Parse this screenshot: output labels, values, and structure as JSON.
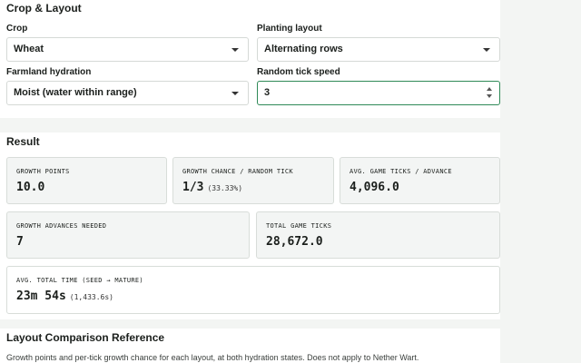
{
  "crop_layout": {
    "title": "Crop & Layout",
    "crop": {
      "label": "Crop",
      "value": "Wheat"
    },
    "planting_layout": {
      "label": "Planting layout",
      "value": "Alternating rows"
    },
    "hydration": {
      "label": "Farmland hydration",
      "value": "Moist (water within range)"
    },
    "tick_speed": {
      "label": "Random tick speed",
      "value": "3"
    }
  },
  "result": {
    "title": "Result",
    "growth_points": {
      "label": "GROWTH POINTS",
      "value": "10.0"
    },
    "growth_chance": {
      "label": "GROWTH CHANCE / RANDOM TICK",
      "value": "1/3",
      "sub": "(33.33%)"
    },
    "avg_ticks": {
      "label": "AVG. GAME TICKS / ADVANCE",
      "value": "4,096.0"
    },
    "advances_needed": {
      "label": "GROWTH ADVANCES NEEDED",
      "value": "7"
    },
    "total_ticks": {
      "label": "TOTAL GAME TICKS",
      "value": "28,672.0"
    },
    "total_time": {
      "label": "AVG. TOTAL TIME (SEED → MATURE)",
      "value": "23m 54s",
      "sub": "(1,433.6s)"
    }
  },
  "reference": {
    "title": "Layout Comparison Reference",
    "description": "Growth points and per-tick growth chance for each layout, at both hydration states. Does not apply to Nether Wart."
  }
}
